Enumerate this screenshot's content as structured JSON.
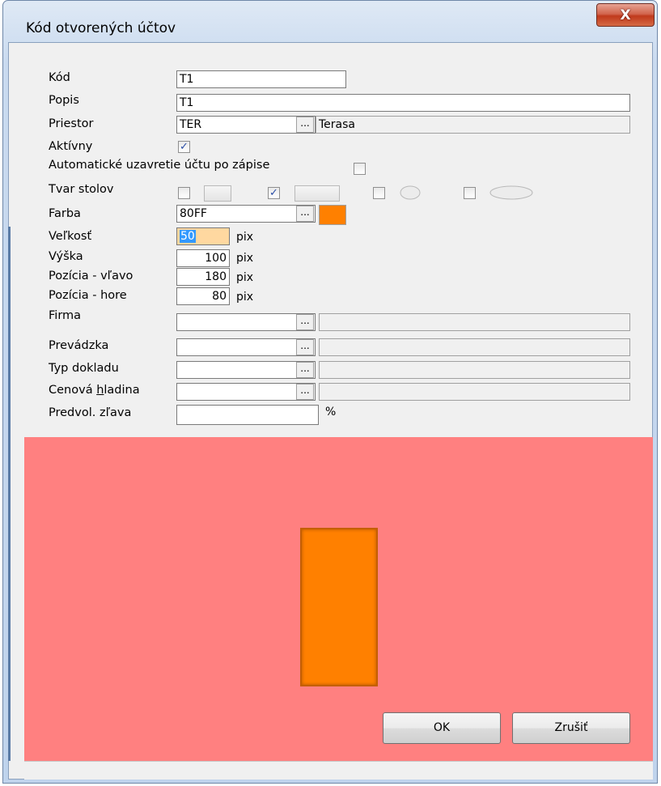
{
  "window": {
    "title": "Kód otvorených účtov",
    "close_glyph": "X"
  },
  "fields": {
    "kod": {
      "label": "Kód",
      "value": "T1"
    },
    "popis": {
      "label": "Popis",
      "value": "T1"
    },
    "priestor": {
      "label": "Priestor",
      "value": "TER",
      "description": "Terasa"
    },
    "aktivny": {
      "label": "Aktívny",
      "checked": true
    },
    "auto_close": {
      "label": "Automatické uzavretie účtu po zápise",
      "checked": false
    },
    "tvar": {
      "label": "Tvar stolov",
      "options": [
        "small-rect",
        "wide-rect",
        "small-ellipse",
        "wide-ellipse"
      ],
      "selected": 1
    },
    "farba": {
      "label": "Farba",
      "value": "80FF",
      "swatch": "#ff8000"
    },
    "velkost": {
      "label": "Veľkosť",
      "value": "50",
      "unit": "pix"
    },
    "vyska": {
      "label": "Výška",
      "value": "100",
      "unit": "pix"
    },
    "pozicia_vlavo": {
      "label": "Pozícia - vľavo",
      "value": "180",
      "unit": "pix"
    },
    "pozicia_hore": {
      "label": "Pozícia - hore",
      "value": "80",
      "unit": "pix"
    },
    "firma": {
      "label": "Firma",
      "value": "",
      "description": ""
    },
    "prevadzka": {
      "label": "Prevádzka",
      "value": "",
      "description": ""
    },
    "typ_dokladu": {
      "label": "Typ dokladu",
      "value": "",
      "description": ""
    },
    "cenova_hladina": {
      "label_pre": "Cenová ",
      "label_ul": "h",
      "label_post": "ladina",
      "value": "",
      "description": ""
    },
    "predvol_zlava": {
      "label": "Predvol. zľava",
      "value": "",
      "unit": "%"
    }
  },
  "ellipsis": "...",
  "buttons": {
    "ok": "OK",
    "cancel": "Zrušiť"
  },
  "colors": {
    "preview_background": "#ff8080",
    "table_color": "#ff8000"
  }
}
